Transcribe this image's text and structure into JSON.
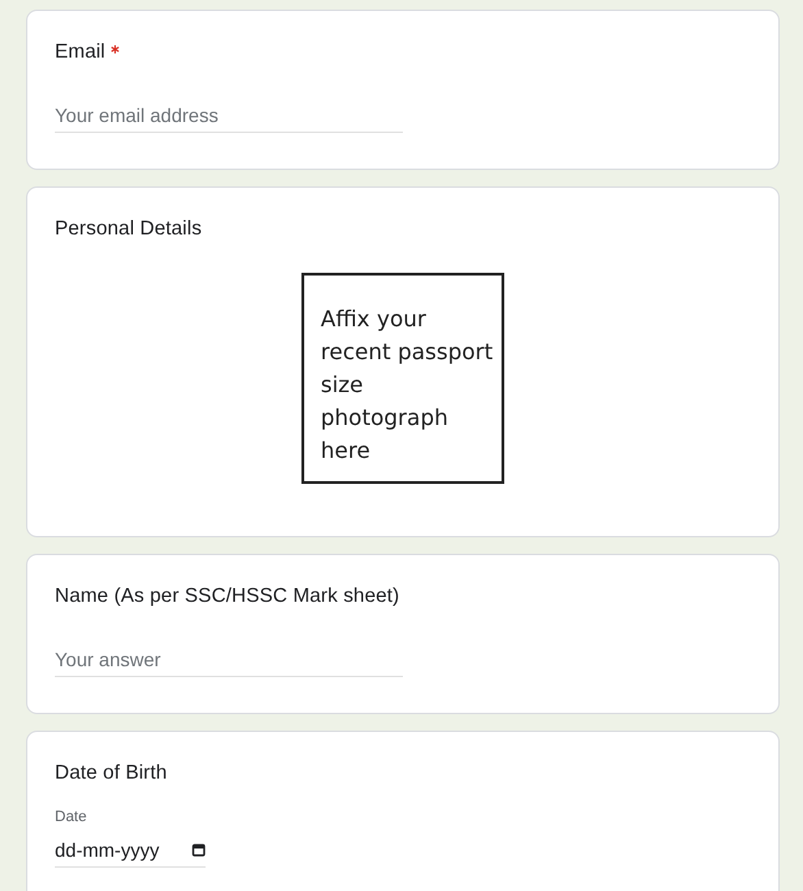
{
  "questions": [
    {
      "kind": "text",
      "title": "Email",
      "required": true,
      "placeholder": "Your email address"
    },
    {
      "kind": "image",
      "title": "Personal Details",
      "image_text": "Affix your recent passport size photograph here"
    },
    {
      "kind": "text",
      "title": "Name (As per SSC/HSSC Mark sheet)",
      "required": false,
      "placeholder": "Your answer"
    },
    {
      "kind": "date",
      "title": "Date of Birth",
      "label": "Date",
      "value": "dd-mm-yyyy"
    }
  ]
}
